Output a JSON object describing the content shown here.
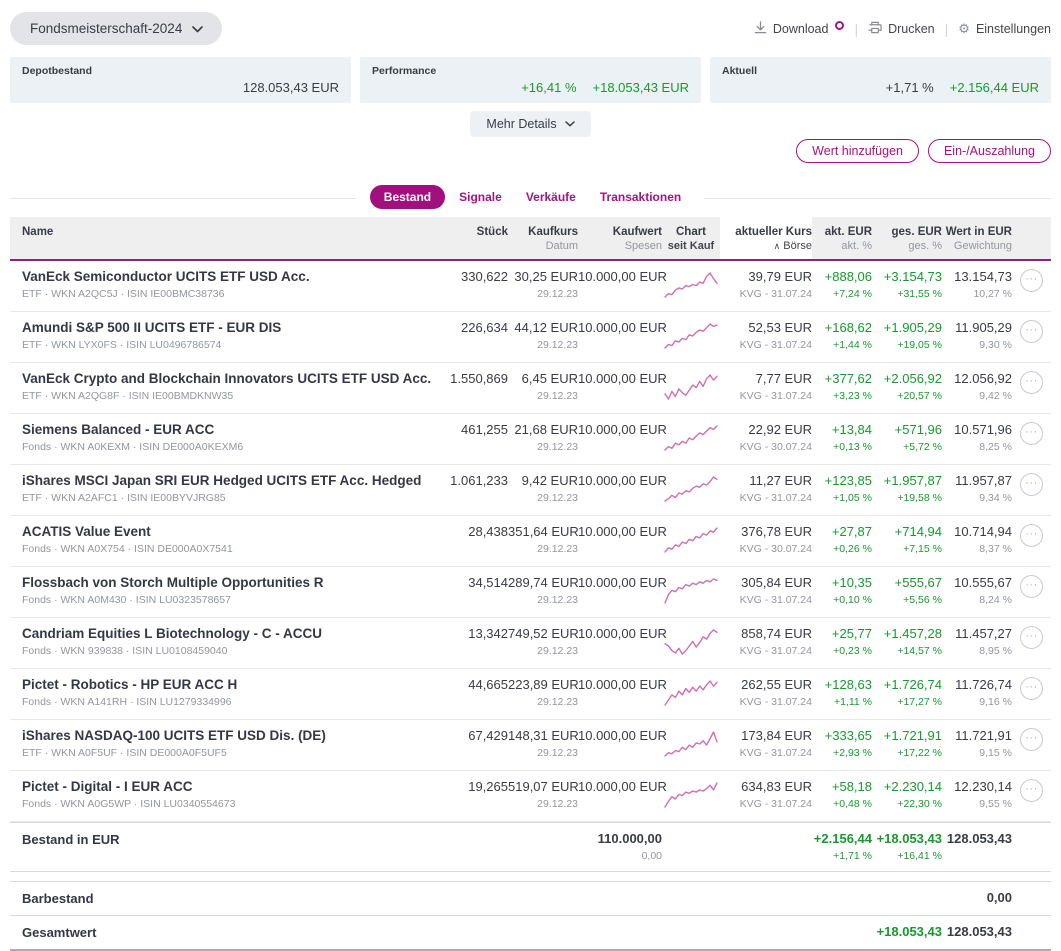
{
  "colors": {
    "accent_magenta": "#a2157f",
    "header_purple": "#8c2383",
    "positive_green": "#169a2e",
    "spark_pink": "#cf6fb3",
    "card_bg": "#ecf1f5",
    "dark_text": "#373c47",
    "muted_text": "#9097a1"
  },
  "icons": {
    "gear": "⚙",
    "sort_asc": "∧",
    "menu_dots": "···"
  },
  "header": {
    "portfolio_selector": "Fondsmeisterschaft-2024",
    "toolbar": {
      "download": "Download",
      "print": "Drucken",
      "settings": "Einstellungen"
    }
  },
  "summary_cards": [
    {
      "label": "Depotbestand",
      "value": "128.053,43 EUR"
    },
    {
      "label": "Performance",
      "percent": "+16,41 %",
      "value": "+18.053,43 EUR"
    },
    {
      "label": "Aktuell",
      "percent": "+1,71 %",
      "value": "+2.156,44 EUR"
    }
  ],
  "more_details_label": "Mehr Details",
  "action_buttons": {
    "add_value": "Wert hinzufügen",
    "deposit_withdraw": "Ein-/Auszahlung"
  },
  "tabs": [
    {
      "label": "Bestand",
      "active": true
    },
    {
      "label": "Signale",
      "active": false
    },
    {
      "label": "Verkäufe",
      "active": false
    },
    {
      "label": "Transaktionen",
      "active": false
    }
  ],
  "table": {
    "columns": [
      {
        "main": "Name",
        "sub": ""
      },
      {
        "main": "Stück",
        "sub": ""
      },
      {
        "main": "Kaufkurs",
        "sub": "Datum"
      },
      {
        "main": "Kaufwert",
        "sub": "Spesen"
      },
      {
        "main": "Chart",
        "sub": "seit Kauf"
      },
      {
        "main": "aktueller Kurs",
        "sub": "Börse",
        "sorted": "asc"
      },
      {
        "main": "akt. EUR",
        "sub": "akt. %"
      },
      {
        "main": "ges. EUR",
        "sub": "ges. %"
      },
      {
        "main": "Wert in EUR",
        "sub": "Gewichtung"
      }
    ],
    "rows": [
      {
        "name": "VanEck Semiconductor UCITS ETF USD Acc.",
        "meta": "ETF · WKN A2QC5J · ISIN IE00BMC38736",
        "pieces": "330,622",
        "buy_price": "30,25 EUR",
        "buy_date": "29.12.23",
        "buy_value": "10.000,00 EUR",
        "current_price": "39,79 EUR",
        "price_source": "KVG - 31.07.24",
        "akt_eur": "+888,06",
        "akt_pct": "+7,24 %",
        "ges_eur": "+3.154,73",
        "ges_pct": "+31,55 %",
        "value": "13.154,73",
        "weight": "10,27 %",
        "spark": [
          3,
          6,
          5,
          9,
          11,
          10,
          13,
          12,
          14,
          13,
          16,
          15,
          21,
          24,
          19,
          15
        ]
      },
      {
        "name": "Amundi S&P 500 II UCITS ETF - EUR DIS",
        "meta": "ETF · WKN LYX0FS · ISIN LU0496786574",
        "pieces": "226,634",
        "buy_price": "44,12 EUR",
        "buy_date": "29.12.23",
        "buy_value": "10.000,00 EUR",
        "current_price": "52,53 EUR",
        "price_source": "KVG - 31.07.24",
        "akt_eur": "+168,62",
        "akt_pct": "+1,44 %",
        "ges_eur": "+1.905,29",
        "ges_pct": "+19,05 %",
        "value": "11.905,29",
        "weight": "9,30 %",
        "spark": [
          2,
          5,
          4,
          8,
          7,
          10,
          9,
          13,
          12,
          15,
          17,
          16,
          19,
          22,
          20,
          21
        ]
      },
      {
        "name": "VanEck Crypto and Blockchain Innovators UCITS ETF USD Acc.",
        "meta": "ETF · WKN A2QG8F · ISIN IE00BMDKNW35",
        "pieces": "1.550,869",
        "buy_price": "6,45 EUR",
        "buy_date": "29.12.23",
        "buy_value": "10.000,00 EUR",
        "current_price": "7,77 EUR",
        "price_source": "KVG - 31.07.24",
        "akt_eur": "+377,62",
        "akt_pct": "+3,23 %",
        "ges_eur": "+2.056,92",
        "ges_pct": "+20,57 %",
        "value": "12.056,92",
        "weight": "9,42 %",
        "spark": [
          8,
          4,
          10,
          6,
          12,
          9,
          7,
          11,
          15,
          13,
          18,
          14,
          20,
          23,
          19,
          22
        ]
      },
      {
        "name": "Siemens Balanced - EUR ACC",
        "meta": "Fonds · WKN A0KEXM · ISIN DE000A0KEXM6",
        "pieces": "461,255",
        "buy_price": "21,68 EUR",
        "buy_date": "29.12.23",
        "buy_value": "10.000,00 EUR",
        "current_price": "22,92 EUR",
        "price_source": "KVG - 30.07.24",
        "akt_eur": "+13,84",
        "akt_pct": "+0,13 %",
        "ges_eur": "+571,96",
        "ges_pct": "+5,72 %",
        "value": "10.571,96",
        "weight": "8,25 %",
        "spark": [
          4,
          6,
          5,
          8,
          7,
          9,
          8,
          11,
          10,
          12,
          14,
          13,
          15,
          17,
          16,
          18
        ]
      },
      {
        "name": "iShares MSCI Japan SRI EUR Hedged UCITS ETF Acc. Hedged",
        "meta": "ETF · WKN A2AFC1 · ISIN IE00BYVJRG85",
        "pieces": "1.061,233",
        "buy_price": "9,42 EUR",
        "buy_date": "29.12.23",
        "buy_value": "10.000,00 EUR",
        "current_price": "11,27 EUR",
        "price_source": "KVG - 31.07.24",
        "akt_eur": "+123,85",
        "akt_pct": "+1,05 %",
        "ges_eur": "+1.957,87",
        "ges_pct": "+19,58 %",
        "value": "11.957,87",
        "weight": "9,34 %",
        "spark": [
          3,
          5,
          8,
          6,
          10,
          9,
          12,
          11,
          14,
          16,
          15,
          18,
          17,
          20,
          24,
          22
        ]
      },
      {
        "name": "ACATIS Value Event",
        "meta": "Fonds · WKN A0X754 · ISIN DE000A0X7541",
        "pieces": "28,438",
        "buy_price": "351,64 EUR",
        "buy_date": "29.12.23",
        "buy_value": "10.000,00 EUR",
        "current_price": "376,78 EUR",
        "price_source": "KVG - 30.07.24",
        "akt_eur": "+27,87",
        "akt_pct": "+0,26 %",
        "ges_eur": "+714,94",
        "ges_pct": "+7,15 %",
        "value": "10.714,94",
        "weight": "8,37 %",
        "spark": [
          4,
          7,
          6,
          9,
          8,
          11,
          10,
          13,
          12,
          15,
          14,
          17,
          16,
          19,
          18,
          21
        ]
      },
      {
        "name": "Flossbach von Storch Multiple Opportunities R",
        "meta": "Fonds · WKN A0M430 · ISIN LU0323578657",
        "pieces": "34,514",
        "buy_price": "289,74 EUR",
        "buy_date": "29.12.23",
        "buy_value": "10.000,00 EUR",
        "current_price": "305,84 EUR",
        "price_source": "KVG - 31.07.24",
        "akt_eur": "+10,35",
        "akt_pct": "+0,10 %",
        "ges_eur": "+555,67",
        "ges_pct": "+5,56 %",
        "value": "10.555,67",
        "weight": "8,24 %",
        "spark": [
          2,
          8,
          11,
          10,
          13,
          12,
          15,
          14,
          16,
          15,
          17,
          16,
          18,
          17,
          19,
          18
        ]
      },
      {
        "name": "Candriam Equities L Biotechnology - C - ACCU",
        "meta": "Fonds · WKN 939838 · ISIN LU0108459040",
        "pieces": "13,342",
        "buy_price": "749,52 EUR",
        "buy_date": "29.12.23",
        "buy_value": "10.000,00 EUR",
        "current_price": "858,74 EUR",
        "price_source": "KVG - 31.07.24",
        "akt_eur": "+25,77",
        "akt_pct": "+0,23 %",
        "ges_eur": "+1.457,28",
        "ges_pct": "+14,57 %",
        "value": "11.457,27",
        "weight": "8,95 %",
        "spark": [
          12,
          10,
          6,
          4,
          8,
          3,
          6,
          10,
          14,
          9,
          13,
          18,
          16,
          21,
          24,
          22
        ]
      },
      {
        "name": "Pictet - Robotics - HP EUR ACC H",
        "meta": "Fonds · WKN A141RH · ISIN LU1279334996",
        "pieces": "44,665",
        "buy_price": "223,89 EUR",
        "buy_date": "29.12.23",
        "buy_value": "10.000,00 EUR",
        "current_price": "262,55 EUR",
        "price_source": "KVG - 31.07.24",
        "akt_eur": "+128,63",
        "akt_pct": "+1,11 %",
        "ges_eur": "+1.726,74",
        "ges_pct": "+17,27 %",
        "value": "11.726,74",
        "weight": "9,16 %",
        "spark": [
          5,
          9,
          13,
          11,
          16,
          13,
          18,
          15,
          19,
          16,
          20,
          17,
          21,
          24,
          20,
          23
        ]
      },
      {
        "name": "iShares NASDAQ-100 UCITS ETF USD Dis. (DE)",
        "meta": "ETF · WKN A0F5UF · ISIN DE000A0F5UF5",
        "pieces": "67,429",
        "buy_price": "148,31 EUR",
        "buy_date": "29.12.23",
        "buy_value": "10.000,00 EUR",
        "current_price": "173,84 EUR",
        "price_source": "KVG - 31.07.24",
        "akt_eur": "+333,65",
        "akt_pct": "+2,93 %",
        "ges_eur": "+1.721,91",
        "ges_pct": "+17,22 %",
        "value": "11.721,91",
        "weight": "9,15 %",
        "spark": [
          4,
          7,
          6,
          9,
          8,
          12,
          10,
          14,
          12,
          16,
          15,
          18,
          14,
          20,
          26,
          17
        ]
      },
      {
        "name": "Pictet - Digital - I EUR ACC",
        "meta": "Fonds · WKN A0G5WP · ISIN LU0340554673",
        "pieces": "19,265",
        "buy_price": "519,07 EUR",
        "buy_date": "29.12.23",
        "buy_value": "10.000,00 EUR",
        "current_price": "634,83 EUR",
        "price_source": "KVG - 31.07.24",
        "akt_eur": "+58,18",
        "akt_pct": "+0,48 %",
        "ges_eur": "+2.230,14",
        "ges_pct": "+22,30 %",
        "value": "12.230,14",
        "weight": "9,55 %",
        "spark": [
          3,
          8,
          12,
          10,
          14,
          13,
          16,
          15,
          17,
          16,
          18,
          17,
          19,
          22,
          18,
          24
        ]
      }
    ],
    "totals": {
      "bestand": {
        "label": "Bestand in EUR",
        "kaufwert": "110.000,00",
        "spesen": "0,00",
        "akt_eur": "+2.156,44",
        "akt_pct": "+1,71 %",
        "ges_eur": "+18.053,43",
        "ges_pct": "+16,41 %",
        "value": "128.053,43"
      },
      "barbestand": {
        "label": "Barbestand",
        "value": "0,00"
      },
      "gesamtwert": {
        "label": "Gesamtwert",
        "ges_eur": "+18.053,43",
        "value": "128.053,43"
      }
    }
  }
}
